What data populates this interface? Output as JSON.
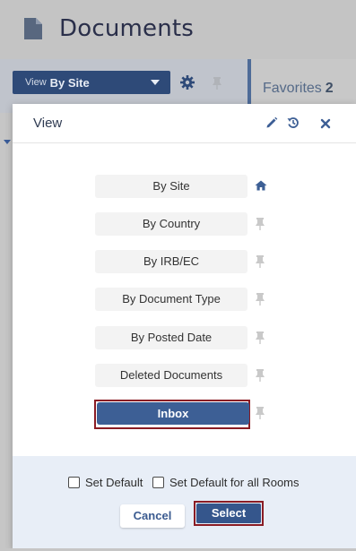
{
  "page": {
    "title": "Documents",
    "view_dropdown": {
      "prefix": "View",
      "value": "By Site"
    },
    "favorites": {
      "label": "Favorites",
      "count": "2"
    }
  },
  "modal": {
    "title": "View",
    "options": [
      {
        "label": "By Site",
        "icon": "home-icon",
        "selected": false
      },
      {
        "label": "By Country",
        "icon": "pin-icon",
        "selected": false
      },
      {
        "label": "By IRB/EC",
        "icon": "pin-icon",
        "selected": false
      },
      {
        "label": "By Document Type",
        "icon": "pin-icon",
        "selected": false
      },
      {
        "label": "By Posted Date",
        "icon": "pin-icon",
        "selected": false
      },
      {
        "label": "Deleted Documents",
        "icon": "pin-icon",
        "selected": false
      },
      {
        "label": "Inbox",
        "icon": "pin-icon",
        "selected": true
      }
    ],
    "footer": {
      "set_default_label": "Set Default",
      "set_default_all_label": "Set Default for all Rooms",
      "cancel_label": "Cancel",
      "select_label": "Select"
    }
  },
  "colors": {
    "accent": "#3d5f95",
    "highlight_outline": "#8a1c24",
    "footer_bg": "#e8eef7"
  }
}
